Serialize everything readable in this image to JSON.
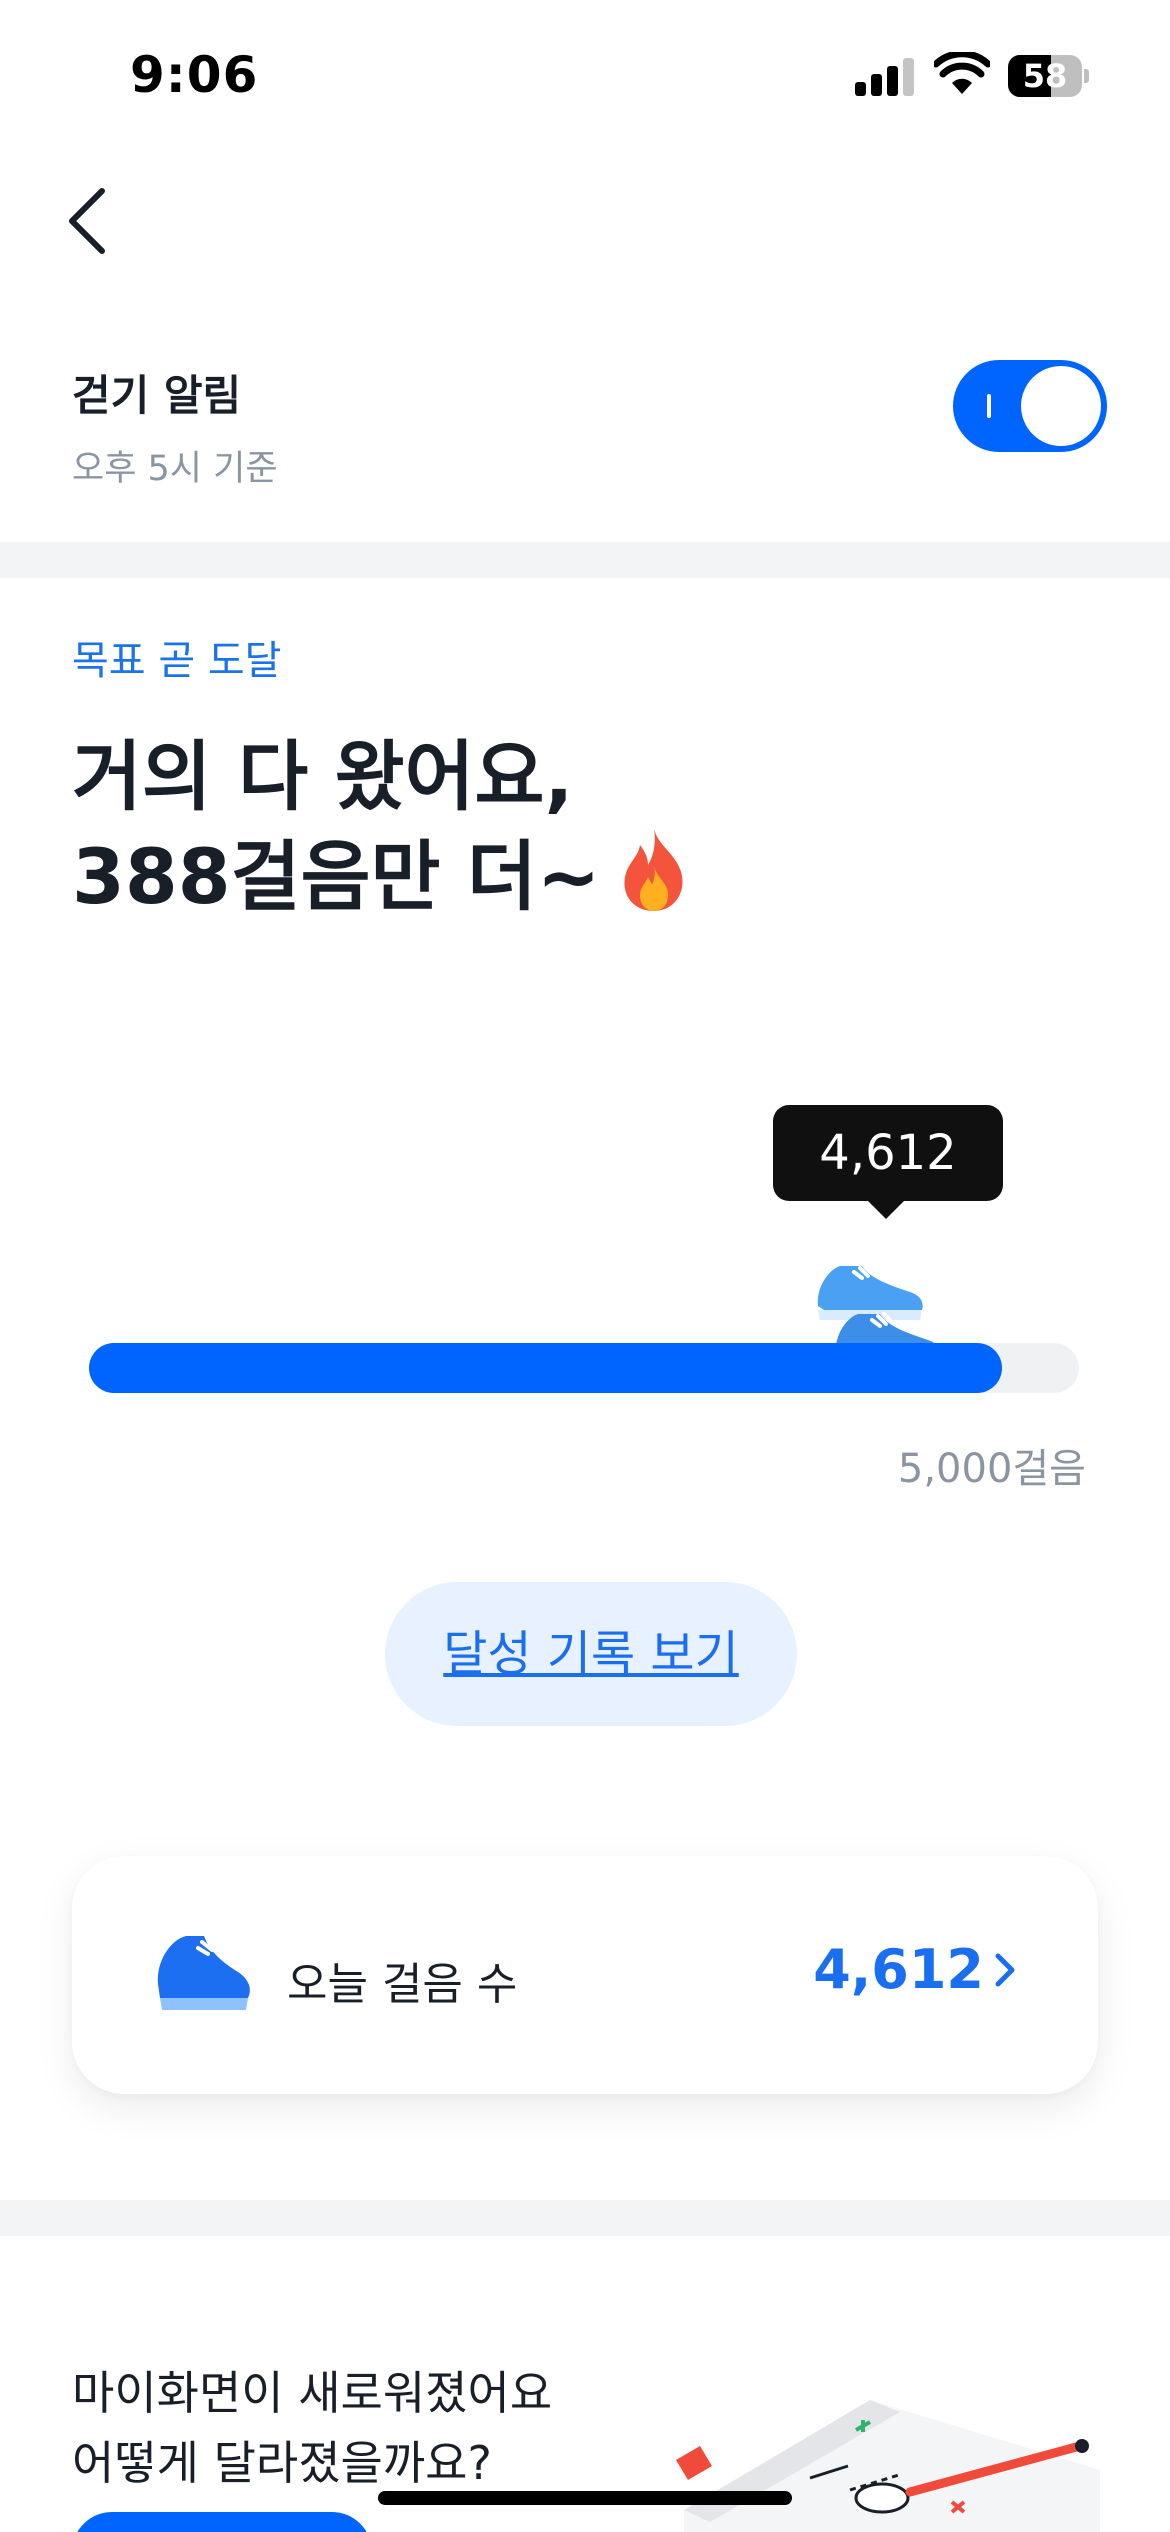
{
  "status_bar": {
    "time": "9:06",
    "battery": "58"
  },
  "walk_alarm": {
    "title": "걷기 알림",
    "subtitle": "오후 5시 기준",
    "enabled": true
  },
  "goal": {
    "tag": "목표 곧 도달",
    "headline_line1": "거의 다 왔어요,",
    "headline_line2": "388걸음만 더~",
    "current_steps_label": "4,612",
    "current_steps": 4612,
    "goal_steps": 5000,
    "goal_label": "5,000걸음",
    "history_button": "달성 기록 보기"
  },
  "today": {
    "label": "오늘 걸음 수",
    "value": "4,612"
  },
  "promo": {
    "line1": "마이화면이 새로워졌어요",
    "line2": "어떻게 달라졌을까요?"
  },
  "colors": {
    "accent": "#0064ff",
    "link": "#1a6ff0",
    "muted": "#8b95a1",
    "divider": "#f2f4f6"
  },
  "icons": [
    "back-chevron-icon",
    "fire-icon",
    "sneakers-icon",
    "shoe-icon",
    "chevron-right-icon"
  ]
}
